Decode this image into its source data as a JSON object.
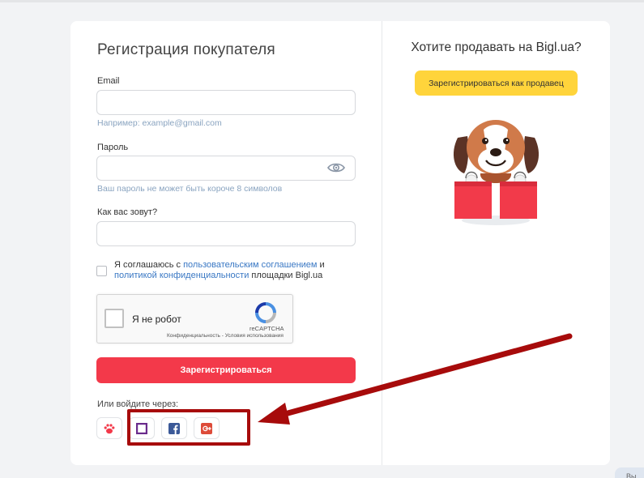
{
  "form": {
    "title": "Регистрация покупателя",
    "email_label": "Email",
    "email_value": "",
    "email_hint": "Например: example@gmail.com",
    "password_label": "Пароль",
    "password_value": "",
    "password_hint": "Ваш пароль не может быть короче 8 символов",
    "name_label": "Как вас зовут?",
    "name_value": "",
    "agree_prefix": "Я соглашаюсь с ",
    "agree_link1": "пользовательским соглашением",
    "agree_mid": " и ",
    "agree_link2": "политикой конфиденциальности",
    "agree_suffix": " площадки Bigl.ua",
    "agree_checked": false,
    "captcha_label": "Я не робот",
    "captcha_brand": "reCAPTCHA",
    "captcha_links": "Конфиденциальность - Условия использования",
    "register_button": "Зарегистрироваться",
    "or_login_label": "Или войдите через:",
    "social": [
      {
        "name": "paw-icon",
        "color": "#f3394a"
      },
      {
        "name": "square-icon",
        "color": "#6a2b8c"
      },
      {
        "name": "facebook-icon",
        "color": "#3b5998"
      },
      {
        "name": "google-plus-icon",
        "color": "#dd4b39"
      }
    ]
  },
  "seller": {
    "title": "Хотите продавать на Bigl.ua?",
    "button": "Зарегистрироваться как продавец"
  },
  "chat_tab_label": "Вы",
  "colors": {
    "primary_red": "#f3394a",
    "seller_yellow": "#ffd43b",
    "link_blue": "#3a78c4",
    "annotation_red": "#a70b0b"
  }
}
